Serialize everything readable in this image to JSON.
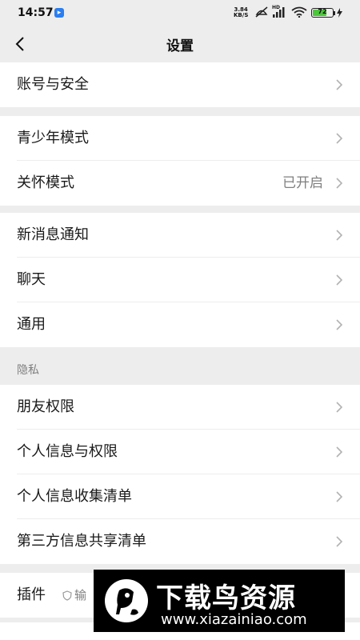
{
  "status_bar": {
    "time": "14:57",
    "speed_value": "3.84",
    "speed_unit": "KB/S",
    "battery": "72",
    "battery_level": 0.72,
    "signal_tag": "HD"
  },
  "nav": {
    "title": "设置"
  },
  "groups": {
    "account": {
      "label": "账号与安全"
    },
    "youth": {
      "label": "青少年模式"
    },
    "care": {
      "label": "关怀模式",
      "value": "已开启"
    },
    "notify": {
      "label": "新消息通知"
    },
    "chat": {
      "label": "聊天"
    },
    "general": {
      "label": "通用"
    },
    "privacy_header": "隐私",
    "friends": {
      "label": "朋友权限"
    },
    "personal_info": {
      "label": "个人信息与权限"
    },
    "collect_list": {
      "label": "个人信息收集清单"
    },
    "third_party": {
      "label": "第三方信息共享清单"
    },
    "plugins": {
      "label": "插件",
      "sub": "输"
    }
  },
  "watermark": {
    "title": "下载鸟资源",
    "url": "www.xiazainiao.com"
  },
  "colors": {
    "background": "#ededed",
    "card": "#ffffff",
    "battery": "#4cc63a"
  }
}
